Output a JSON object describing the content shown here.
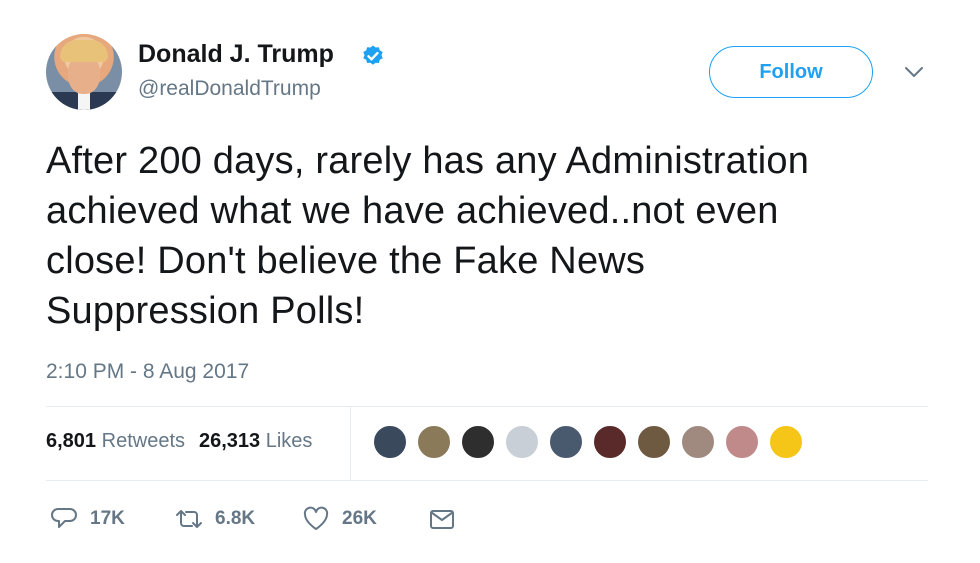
{
  "tweet": {
    "author_name": "Donald J. Trump",
    "handle": "@realDonaldTrump",
    "verified": true,
    "follow_label": "Follow",
    "text_lines": [
      "After 200 days, rarely has any Administration",
      "achieved what we have achieved..not even",
      "close! Don't believe the Fake News",
      "Suppression Polls!"
    ],
    "timestamp": "2:10 PM - 8 Aug 2017"
  },
  "stats": {
    "retweets_count": "6,801",
    "retweets_label": "Retweets",
    "likes_count": "26,313",
    "likes_label": "Likes"
  },
  "likers": [
    {
      "name": "liker-1",
      "color": "#3a4a5c"
    },
    {
      "name": "liker-2",
      "color": "#8a7a5a"
    },
    {
      "name": "liker-3",
      "color": "#2e2e2e"
    },
    {
      "name": "liker-4",
      "color": "#c9cfd6"
    },
    {
      "name": "liker-5",
      "color": "#4a5a6e"
    },
    {
      "name": "liker-6",
      "color": "#5a2a2a"
    },
    {
      "name": "liker-7",
      "color": "#6e5a40"
    },
    {
      "name": "liker-8",
      "color": "#a08a80"
    },
    {
      "name": "liker-9",
      "color": "#c08a8a"
    },
    {
      "name": "liker-10",
      "color": "#f5c518"
    }
  ],
  "actions": {
    "reply_count": "17K",
    "retweet_count": "6.8K",
    "like_count": "26K"
  },
  "colors": {
    "accent": "#1da1f2",
    "secondary_text": "#657786",
    "primary_text": "#14171a"
  },
  "icons": [
    "verified-badge-icon",
    "chevron-down-icon",
    "reply-icon",
    "retweet-icon",
    "heart-icon",
    "message-icon"
  ]
}
